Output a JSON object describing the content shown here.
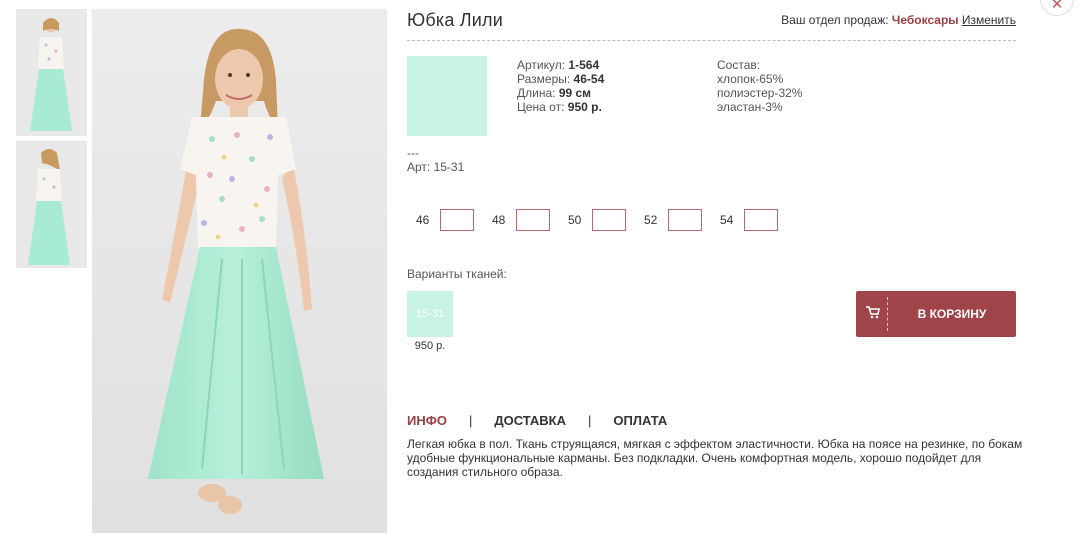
{
  "product": {
    "title": "Юбка Лили",
    "specs": {
      "article_label": "Артикул:",
      "article_value": "1-564",
      "sizes_label": "Размеры:",
      "sizes_value": "46-54",
      "length_label": "Длина:",
      "length_value": "99 см",
      "price_label": "Цена от:",
      "price_value": "950 р."
    },
    "composition": {
      "label": "Состав:",
      "items": [
        "хлопок-65%",
        "полиэстер-32%",
        "эластан-3%"
      ]
    },
    "dashes": "---",
    "art": "Арт: 15-31",
    "swatch_color": "#c8f3e2"
  },
  "region": {
    "label": "Ваш отдел продаж:",
    "city": "Чебоксары",
    "change_label": "Изменить"
  },
  "sizes": [
    {
      "label": "46",
      "value": ""
    },
    {
      "label": "48",
      "value": ""
    },
    {
      "label": "50",
      "value": ""
    },
    {
      "label": "52",
      "value": ""
    },
    {
      "label": "54",
      "value": ""
    }
  ],
  "fabric": {
    "title": "Варианты тканей:",
    "variants": [
      {
        "code": "15-31",
        "price": "950 р.",
        "color": "#c8f3e2"
      }
    ]
  },
  "cart": {
    "label": "В КОРЗИНУ",
    "icon": "cart-icon",
    "color": "#a0444a"
  },
  "tabs": [
    {
      "label": "ИНФО",
      "active": true
    },
    {
      "label": "ДОСТАВКА",
      "active": false
    },
    {
      "label": "ОПЛАТА",
      "active": false
    }
  ],
  "tab_separator": "|",
  "description": "Легкая юбка в пол. Ткань струящаяся, мягкая с эффектом эластичности. Юбка на поясе на резинке, по бокам удобные функциональные карманы. Без подкладки. Очень комфортная модель, хорошо подойдет для создания стильного образа.",
  "close_icon": "close-icon",
  "colors": {
    "accent": "#9b3f45",
    "mint": "#c8f3e2"
  }
}
